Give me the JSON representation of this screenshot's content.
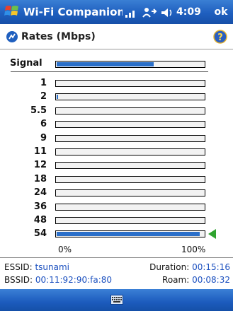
{
  "titlebar": {
    "app_title": "Wi-Fi Companion",
    "time": "4:09",
    "ok_label": "ok"
  },
  "header": {
    "title": "Rates (Mbps)"
  },
  "signal": {
    "label": "Signal",
    "level_fraction": 0.66
  },
  "rates": [
    {
      "label": "1",
      "fraction": 0.0
    },
    {
      "label": "2",
      "fraction": 0.01
    },
    {
      "label": "5.5",
      "fraction": 0.0
    },
    {
      "label": "6",
      "fraction": 0.0
    },
    {
      "label": "9",
      "fraction": 0.0
    },
    {
      "label": "11",
      "fraction": 0.0
    },
    {
      "label": "12",
      "fraction": 0.0
    },
    {
      "label": "18",
      "fraction": 0.0
    },
    {
      "label": "24",
      "fraction": 0.0
    },
    {
      "label": "36",
      "fraction": 0.0
    },
    {
      "label": "48",
      "fraction": 0.0
    },
    {
      "label": "54",
      "fraction": 0.97,
      "current": true
    }
  ],
  "axis": {
    "min_label": "0%",
    "max_label": "100%"
  },
  "info": {
    "essid_label": "ESSID:",
    "essid_value": "tsunami",
    "bssid_label": "BSSID:",
    "bssid_value": "00:11:92:90:fa:80",
    "duration_label": "Duration:",
    "duration_value": "00:15:16",
    "roam_label": "Roam:",
    "roam_value": "00:08:32"
  },
  "colors": {
    "bar_fill": "#2a6fc9",
    "marker": "#2fa32f",
    "title_bar": "#1f5fbf",
    "value_text": "#1a4fbf"
  },
  "icons": [
    "windows-start-icon",
    "signal-strength-icon",
    "connectivity-icon",
    "volume-icon",
    "rates-icon",
    "help-icon",
    "keyboard-icon"
  ]
}
